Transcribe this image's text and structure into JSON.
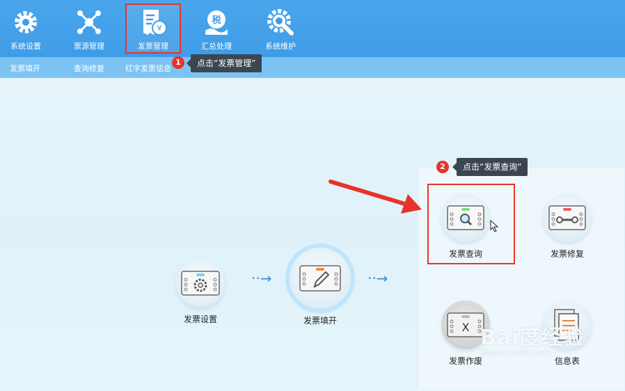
{
  "toolbar": {
    "items": [
      {
        "label": "系统设置",
        "icon": "gear-icon"
      },
      {
        "label": "票源管理",
        "icon": "network-icon"
      },
      {
        "label": "发票管理",
        "icon": "invoice-icon"
      },
      {
        "label": "汇总处理",
        "icon": "tax-summary-icon"
      },
      {
        "label": "系统维护",
        "icon": "maintenance-icon"
      }
    ],
    "active_index": 2
  },
  "subnav": {
    "items": [
      "发票填开",
      "查询修复",
      "红字发票信息"
    ]
  },
  "tooltips": {
    "step1": {
      "number": "1",
      "text": "点击“发票管理”"
    },
    "step2": {
      "number": "2",
      "text": "点击“发票查询”"
    }
  },
  "flow": {
    "setup": "发票设置",
    "issue": "发票填开"
  },
  "panel": {
    "query": "发票查询",
    "repair": "发票修复",
    "void": "发票作废",
    "info": "信息表"
  },
  "watermark": {
    "logo": "Bai度经验",
    "url": "jingyan.baidu.com"
  },
  "colors": {
    "topbar": "#3f9ce7",
    "subbar": "#7cc3f3",
    "highlight": "#e8332a",
    "tooltip": "#3b4650"
  }
}
